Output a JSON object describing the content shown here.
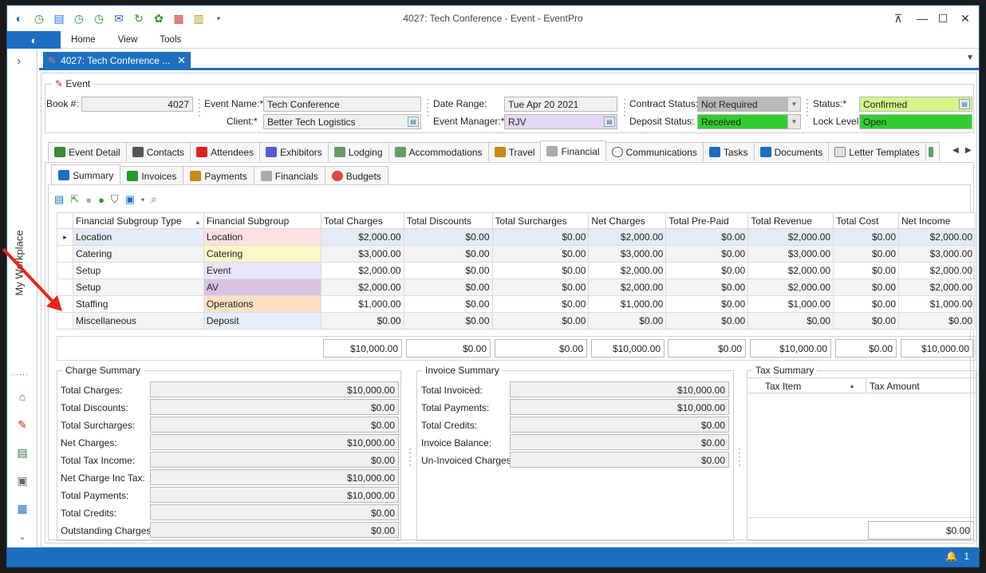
{
  "window": {
    "title": "4027: Tech Conference - Event - EventPro"
  },
  "ribbon": {
    "menu": [
      "Home",
      "View",
      "Tools"
    ]
  },
  "sidebar": {
    "label": "My Workplace",
    "dots": "......"
  },
  "doc_tab": {
    "label": "4027: Tech Conference ..."
  },
  "event": {
    "group_label": "Event",
    "book_label": "Book #:",
    "book": "4027",
    "name_label": "Event Name:*",
    "name": "Tech Conference",
    "client_label": "Client:*",
    "client": "Better Tech Logistics",
    "date_label": "Date Range:",
    "date": "Tue Apr 20 2021",
    "manager_label": "Event Manager:*",
    "manager": "RJV",
    "contract_label": "Contract Status:",
    "contract": "Not Required",
    "deposit_label": "Deposit Status:",
    "deposit": "Received",
    "status_label": "Status:*",
    "status": "Confirmed",
    "lock_label": "Lock Level:",
    "lock": "Open"
  },
  "tabs": [
    "Event Detail",
    "Contacts",
    "Attendees",
    "Exhibitors",
    "Lodging",
    "Accommodations",
    "Travel",
    "Financial",
    "Communications",
    "Tasks",
    "Documents",
    "Letter Templates"
  ],
  "subtabs": [
    "Summary",
    "Invoices",
    "Payments",
    "Financials",
    "Budgets"
  ],
  "grid": {
    "columns": [
      "Financial Subgroup Type",
      "Financial Subgroup",
      "Total Charges",
      "Total Discounts",
      "Total Surcharges",
      "Net Charges",
      "Total Pre-Paid",
      "Total Revenue",
      "Total Cost",
      "Net Income"
    ],
    "rows": [
      [
        "Location",
        "Location",
        "$2,000.00",
        "$0.00",
        "$0.00",
        "$2,000.00",
        "$0.00",
        "$2,000.00",
        "$0.00",
        "$2,000.00"
      ],
      [
        "Catering",
        "Catering",
        "$3,000.00",
        "$0.00",
        "$0.00",
        "$3,000.00",
        "$0.00",
        "$3,000.00",
        "$0.00",
        "$3,000.00"
      ],
      [
        "Setup",
        "Event",
        "$2,000.00",
        "$0.00",
        "$0.00",
        "$2,000.00",
        "$0.00",
        "$2,000.00",
        "$0.00",
        "$2,000.00"
      ],
      [
        "Setup",
        "AV",
        "$2,000.00",
        "$0.00",
        "$0.00",
        "$2,000.00",
        "$0.00",
        "$2,000.00",
        "$0.00",
        "$2,000.00"
      ],
      [
        "Staffing",
        "Operations",
        "$1,000.00",
        "$0.00",
        "$0.00",
        "$1,000.00",
        "$0.00",
        "$1,000.00",
        "$0.00",
        "$1,000.00"
      ],
      [
        "Miscellaneous",
        "Deposit",
        "$0.00",
        "$0.00",
        "$0.00",
        "$0.00",
        "$0.00",
        "$0.00",
        "$0.00",
        "$0.00"
      ]
    ],
    "subgroup_colors": [
      "#fde0e0",
      "#fbf7c6",
      "#e6e6f8",
      "#d9c3e0",
      "#fde1c2",
      "#e3eefb"
    ],
    "totals": [
      "$10,000.00",
      "$0.00",
      "$0.00",
      "$10,000.00",
      "$0.00",
      "$10,000.00",
      "$0.00",
      "$10,000.00"
    ]
  },
  "charge_summary": {
    "title": "Charge Summary",
    "items": [
      {
        "label": "Total Charges:",
        "value": "$10,000.00"
      },
      {
        "label": "Total Discounts:",
        "value": "$0.00"
      },
      {
        "label": "Total Surcharges:",
        "value": "$0.00"
      },
      {
        "label": "Net Charges:",
        "value": "$10,000.00"
      },
      {
        "label": "Total Tax Income:",
        "value": "$0.00"
      },
      {
        "label": "Net Charge Inc Tax:",
        "value": "$10,000.00"
      },
      {
        "label": "Total Payments:",
        "value": "$10,000.00"
      },
      {
        "label": "Total Credits:",
        "value": "$0.00"
      },
      {
        "label": "Outstanding Charges:",
        "value": "$0.00"
      }
    ]
  },
  "invoice_summary": {
    "title": "Invoice Summary",
    "items": [
      {
        "label": "Total Invoiced:",
        "value": "$10,000.00"
      },
      {
        "label": "Total Payments:",
        "value": "$10,000.00"
      },
      {
        "label": "Total Credits:",
        "value": "$0.00"
      },
      {
        "label": "Invoice Balance:",
        "value": "$0.00"
      },
      {
        "label": "Un-Invoiced Charges:",
        "value": "$0.00"
      }
    ]
  },
  "tax_summary": {
    "title": "Tax Summary",
    "col1": "Tax Item",
    "col2": "Tax Amount",
    "total": "$0.00"
  },
  "statusbar": {
    "count": "1"
  },
  "colors": {
    "accent": "#1e6fc1",
    "not_required": "#b9b9b9",
    "received": "#33cc33",
    "confirmed": "#d6f48a",
    "open": "#33cc33",
    "manager": "#e6d6f6",
    "arrow": "#e8261b"
  }
}
